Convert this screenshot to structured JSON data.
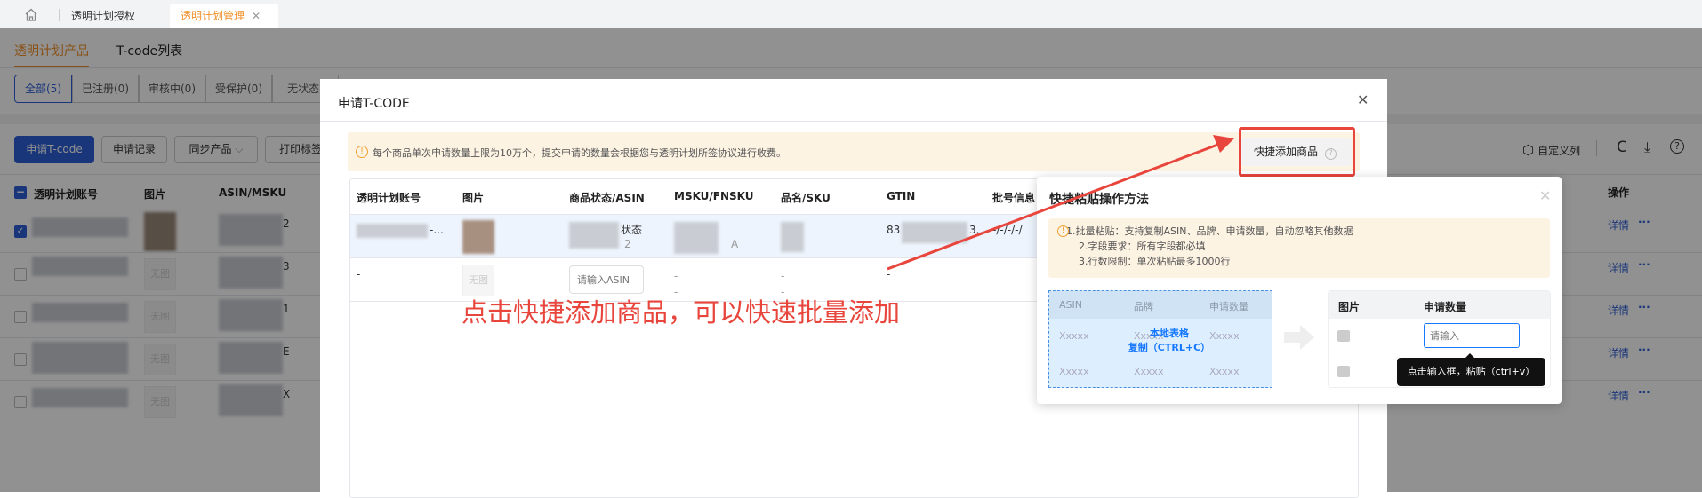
{
  "top_tabs": {
    "home_icon": "home-icon",
    "items": [
      {
        "label": "透明计划授权"
      },
      {
        "label": "透明计划管理"
      }
    ],
    "close_icon": "close-icon"
  },
  "page_tabs": [
    {
      "label": "透明计划产品"
    },
    {
      "label": "T-code列表"
    }
  ],
  "filters": [
    {
      "label": "全部(5)"
    },
    {
      "label": "已注册(0)"
    },
    {
      "label": "审核中(0)"
    },
    {
      "label": "受保护(0)"
    },
    {
      "label": "无状态("
    }
  ],
  "toolbar": {
    "apply": "申请T-code",
    "records": "申请记录",
    "sync": "同步产品",
    "print": "打印标签",
    "custom_columns": "自定义列",
    "icons": [
      "settings-icon",
      "refresh-icon",
      "download-icon",
      "help-icon"
    ]
  },
  "table": {
    "headers": [
      "透明计划账号",
      "图片",
      "ASIN/MSKU",
      "操作"
    ],
    "rows": [
      {
        "asin_tail": "2",
        "checked": true,
        "has_image": true
      },
      {
        "asin_tail": "3",
        "checked": false
      },
      {
        "asin_tail": "1",
        "checked": false
      },
      {
        "asin_tail": "E",
        "checked": false
      },
      {
        "asin_tail": "X",
        "checked": false
      }
    ],
    "no_image": "无图",
    "detail": "详情",
    "more": "···"
  },
  "modal": {
    "title": "申请T-CODE",
    "notice": "每个商品单次申请数量上限为10万个，提交申请的数量会根据您与透明计划所签协议进行收费。",
    "quick_add": "快捷添加商品",
    "headers": [
      "透明计划账号",
      "图片",
      "商品状态/ASIN",
      "MSKU/FNSKU",
      "品名/SKU",
      "GTIN",
      "批号信息"
    ],
    "row1": {
      "account": "-...",
      "status": "状态",
      "asin_tail": "2",
      "fnsku_tail": "A",
      "gtin_head": "83",
      "gtin_tail": "3...",
      "batch": "-/-/-/-/"
    },
    "row2": {
      "account": "-",
      "no_image": "无图",
      "asin_placeholder": "请输入ASIN",
      "dash": "-"
    }
  },
  "annotation": {
    "text": "点击快捷添加商品，可以快速批量添加",
    "color": "#e8453c"
  },
  "popover": {
    "title": "快捷粘贴操作方法",
    "tips": [
      "1.批量粘贴：支持复制ASIN、品牌、申请数量，自动忽略其他数据",
      "2.字段要求：所有字段都必填",
      "3.行数限制：单次粘贴最多1000行"
    ],
    "source_headers": [
      "ASIN",
      "品牌",
      "申请数量"
    ],
    "placeholder_cell": "Xxxxx",
    "source_caption": [
      "本地表格",
      "复制（CTRL+C）"
    ],
    "target_headers": [
      "图片",
      "申请数量"
    ],
    "input_placeholder": "请输入",
    "tooltip": "点击输入框，粘贴（ctrl+v）"
  }
}
